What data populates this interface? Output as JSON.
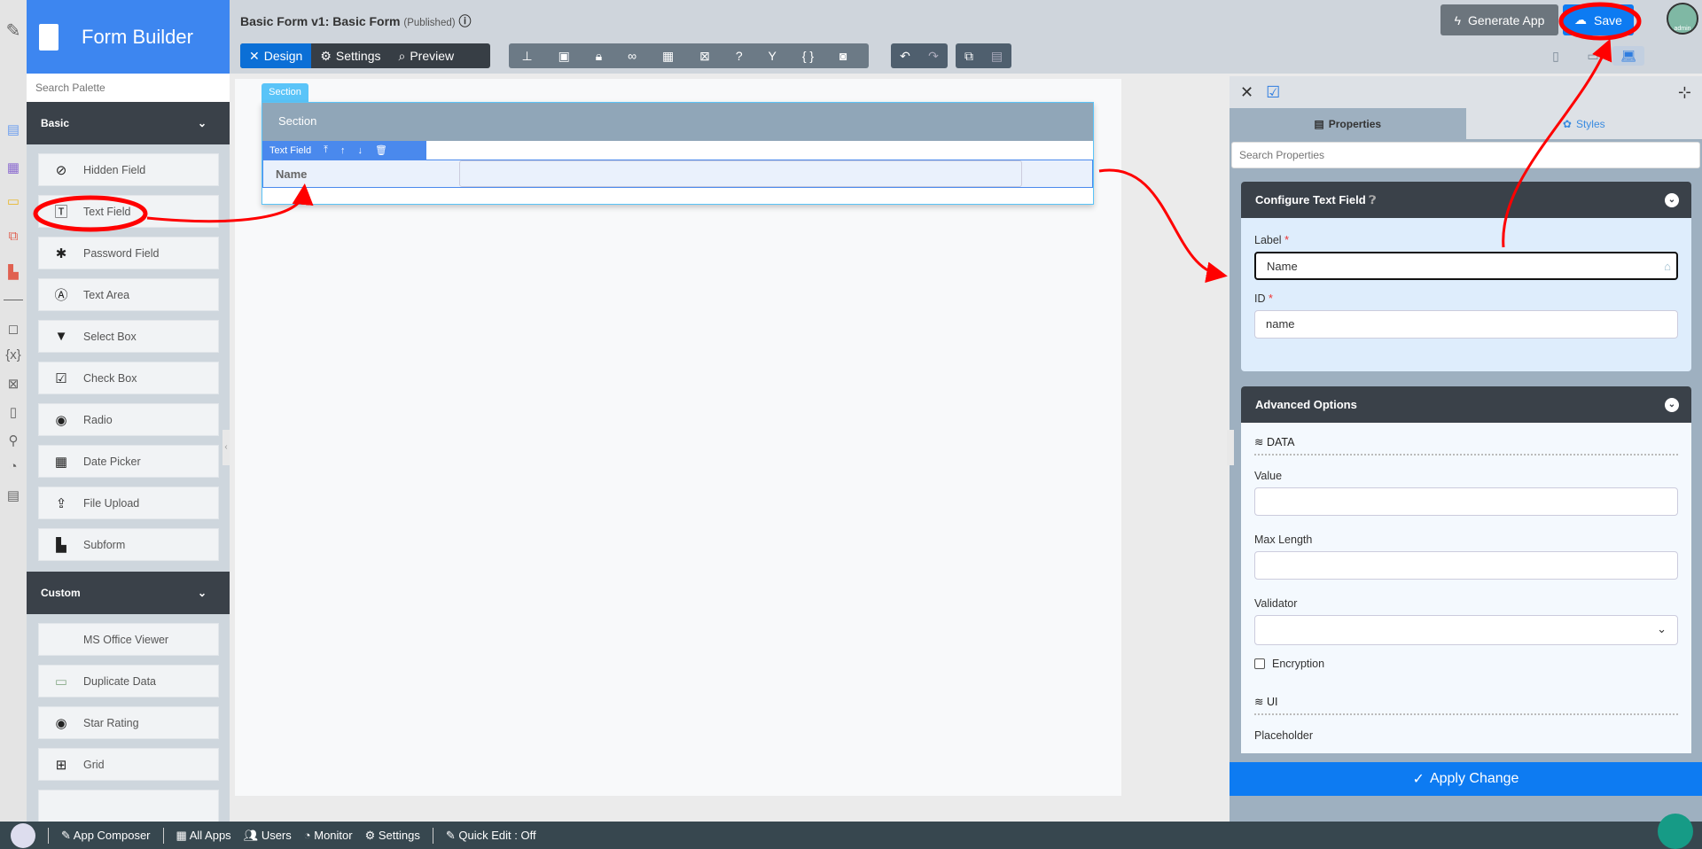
{
  "app": {
    "title": "Form Builder"
  },
  "form": {
    "title": "Basic Form v1: Basic Form",
    "status": "(Published)"
  },
  "modes": [
    {
      "label": "Design",
      "icon": "design-icon"
    },
    {
      "label": "Settings",
      "icon": "gear-icon"
    },
    {
      "label": "Preview",
      "icon": "preview-icon"
    }
  ],
  "tools": [
    "sitemap-icon",
    "field-icon",
    "lock-icon",
    "binoculars-icon",
    "grid-icon",
    "translate-icon",
    "help-icon",
    "branch-icon",
    "code-icon",
    "camera-icon"
  ],
  "actions": {
    "generate": "Generate App",
    "save": "Save",
    "avatar": "admin"
  },
  "palette": {
    "search_placeholder": "Search Palette",
    "basic_label": "Basic",
    "basic": [
      "Hidden Field",
      "Text Field",
      "Password Field",
      "Text Area",
      "Select Box",
      "Check Box",
      "Radio",
      "Date Picker",
      "File Upload",
      "Subform"
    ],
    "custom_label": "Custom",
    "custom": [
      "MS Office Viewer",
      "Duplicate Data",
      "Star Rating",
      "Grid"
    ]
  },
  "canvas": {
    "section_tab": "Section",
    "section_title": "Section",
    "field_tab": "Text Field",
    "field_label": "Name"
  },
  "panel": {
    "tab_properties": "Properties",
    "tab_styles": "Styles",
    "search_placeholder": "Search Properties",
    "configure_title": "Configure Text Field",
    "label_label": "Label",
    "label_value": "Name",
    "id_label": "ID",
    "id_value": "name",
    "advanced_title": "Advanced Options",
    "data_section": "DATA",
    "value_label": "Value",
    "maxlength_label": "Max Length",
    "validator_label": "Validator",
    "encryption_label": "Encryption",
    "encryption_checked": false,
    "ui_section": "UI",
    "placeholder_label": "Placeholder",
    "apply": "Apply Change"
  },
  "bottombar": {
    "app_composer": "App Composer",
    "all_apps": "All Apps",
    "users": "Users",
    "monitor": "Monitor",
    "settings": "Settings",
    "quick_edit": "Quick Edit : Off"
  },
  "colors": {
    "accent": "#0d7bf2",
    "annotation": "#ff0000",
    "dark": "#3a4149"
  }
}
